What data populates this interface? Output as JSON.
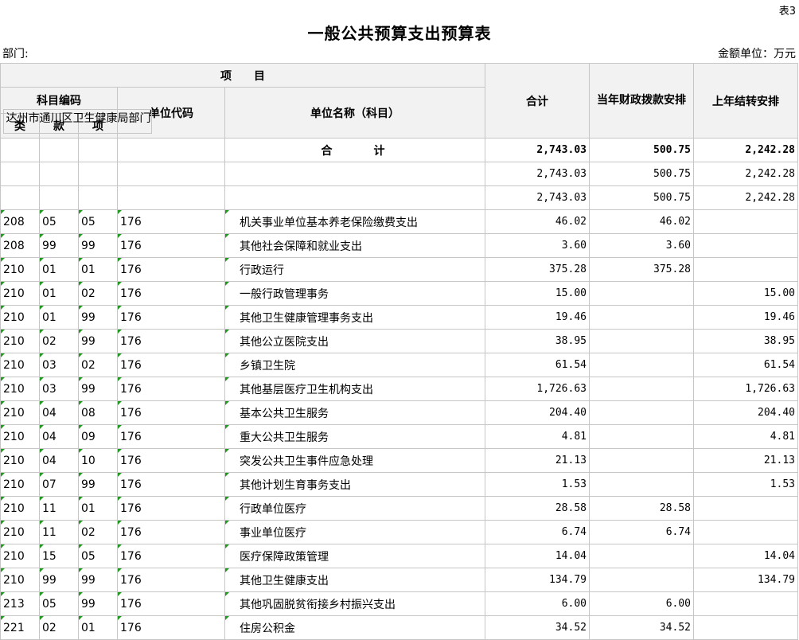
{
  "doc": {
    "table_no": "表3",
    "title": "一般公共预算支出预算表",
    "dept_label": "部门:",
    "unit_label": "金额单位：万元"
  },
  "header": {
    "project": "项　　目",
    "subject_code": "科目编码",
    "lei": "类",
    "kuan": "款",
    "xiang": "项",
    "unit_code": "单位代码",
    "unit_name": "单位名称（科目）",
    "total": "合计",
    "current_year": "当年财政拨款安排",
    "carryover": "上年结转安排"
  },
  "rows": [
    {
      "lei": "",
      "kuan": "",
      "xiang": "",
      "unit": "",
      "name": "合　　计",
      "total": "2,743.03",
      "current": "500.75",
      "carry": "2,242.28",
      "type": "total"
    },
    {
      "lei": "",
      "kuan": "",
      "xiang": "",
      "unit": "",
      "name": "",
      "total": "2,743.03",
      "current": "500.75",
      "carry": "2,242.28",
      "type": "blank"
    },
    {
      "lei": "",
      "kuan": "",
      "xiang": "",
      "unit": "",
      "name": "达州市通川区卫生健康局部门",
      "total": "2,743.03",
      "current": "500.75",
      "carry": "2,242.28",
      "type": "dept"
    },
    {
      "lei": "208",
      "kuan": "05",
      "xiang": "05",
      "unit": "176",
      "name": "机关事业单位基本养老保险缴费支出",
      "total": "46.02",
      "current": "46.02",
      "carry": "",
      "type": "item"
    },
    {
      "lei": "208",
      "kuan": "99",
      "xiang": "99",
      "unit": "176",
      "name": "其他社会保障和就业支出",
      "total": "3.60",
      "current": "3.60",
      "carry": "",
      "type": "item"
    },
    {
      "lei": "210",
      "kuan": "01",
      "xiang": "01",
      "unit": "176",
      "name": "行政运行",
      "total": "375.28",
      "current": "375.28",
      "carry": "",
      "type": "item"
    },
    {
      "lei": "210",
      "kuan": "01",
      "xiang": "02",
      "unit": "176",
      "name": "一般行政管理事务",
      "total": "15.00",
      "current": "",
      "carry": "15.00",
      "type": "item"
    },
    {
      "lei": "210",
      "kuan": "01",
      "xiang": "99",
      "unit": "176",
      "name": "其他卫生健康管理事务支出",
      "total": "19.46",
      "current": "",
      "carry": "19.46",
      "type": "item"
    },
    {
      "lei": "210",
      "kuan": "02",
      "xiang": "99",
      "unit": "176",
      "name": "其他公立医院支出",
      "total": "38.95",
      "current": "",
      "carry": "38.95",
      "type": "item"
    },
    {
      "lei": "210",
      "kuan": "03",
      "xiang": "02",
      "unit": "176",
      "name": "乡镇卫生院",
      "total": "61.54",
      "current": "",
      "carry": "61.54",
      "type": "item"
    },
    {
      "lei": "210",
      "kuan": "03",
      "xiang": "99",
      "unit": "176",
      "name": "其他基层医疗卫生机构支出",
      "total": "1,726.63",
      "current": "",
      "carry": "1,726.63",
      "type": "item"
    },
    {
      "lei": "210",
      "kuan": "04",
      "xiang": "08",
      "unit": "176",
      "name": "基本公共卫生服务",
      "total": "204.40",
      "current": "",
      "carry": "204.40",
      "type": "item"
    },
    {
      "lei": "210",
      "kuan": "04",
      "xiang": "09",
      "unit": "176",
      "name": "重大公共卫生服务",
      "total": "4.81",
      "current": "",
      "carry": "4.81",
      "type": "item"
    },
    {
      "lei": "210",
      "kuan": "04",
      "xiang": "10",
      "unit": "176",
      "name": "突发公共卫生事件应急处理",
      "total": "21.13",
      "current": "",
      "carry": "21.13",
      "type": "item"
    },
    {
      "lei": "210",
      "kuan": "07",
      "xiang": "99",
      "unit": "176",
      "name": "其他计划生育事务支出",
      "total": "1.53",
      "current": "",
      "carry": "1.53",
      "type": "item"
    },
    {
      "lei": "210",
      "kuan": "11",
      "xiang": "01",
      "unit": "176",
      "name": "行政单位医疗",
      "total": "28.58",
      "current": "28.58",
      "carry": "",
      "type": "item"
    },
    {
      "lei": "210",
      "kuan": "11",
      "xiang": "02",
      "unit": "176",
      "name": "事业单位医疗",
      "total": "6.74",
      "current": "6.74",
      "carry": "",
      "type": "item"
    },
    {
      "lei": "210",
      "kuan": "15",
      "xiang": "05",
      "unit": "176",
      "name": "医疗保障政策管理",
      "total": "14.04",
      "current": "",
      "carry": "14.04",
      "type": "item"
    },
    {
      "lei": "210",
      "kuan": "99",
      "xiang": "99",
      "unit": "176",
      "name": "其他卫生健康支出",
      "total": "134.79",
      "current": "",
      "carry": "134.79",
      "type": "item"
    },
    {
      "lei": "213",
      "kuan": "05",
      "xiang": "99",
      "unit": "176",
      "name": "其他巩固脱贫衔接乡村振兴支出",
      "total": "6.00",
      "current": "6.00",
      "carry": "",
      "type": "item"
    },
    {
      "lei": "221",
      "kuan": "02",
      "xiang": "01",
      "unit": "176",
      "name": "住房公积金",
      "total": "34.52",
      "current": "34.52",
      "carry": "",
      "type": "item"
    }
  ]
}
